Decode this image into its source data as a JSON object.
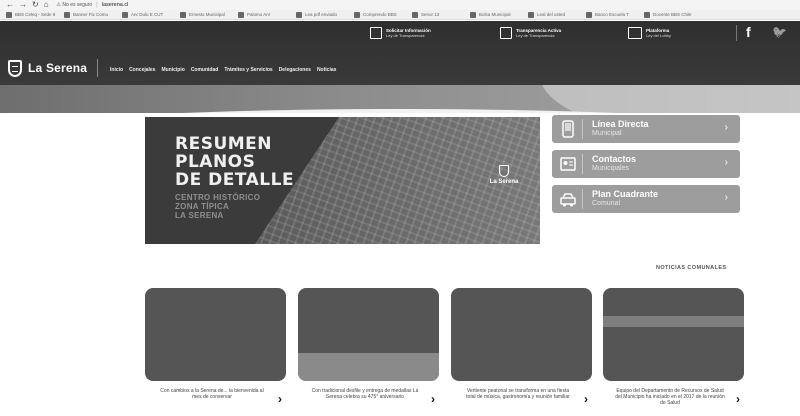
{
  "browser": {
    "secure_label": "No es seguro",
    "url": "laserena.cl",
    "bookmarks": [
      "BBS Celeq - Sede 8",
      "Banner Fix Comu",
      "Anr Dulu E CUT",
      "Ernesto Munisipal",
      "Palomo Anr",
      "Lea pdf enviado",
      "Comprendo BBS",
      "Senor 13",
      "Bolsa Municipal",
      "Leal del usted",
      "Banco Escuela T",
      "Docente BBS Chile"
    ]
  },
  "topbar": {
    "items": [
      {
        "line1": "Solicitar Información",
        "line2": "Ley de Transparencia"
      },
      {
        "line1": "Transparencia Activa",
        "line2": "Ley de Transparencia"
      },
      {
        "line1": "Plataforma",
        "line2": "Ley del Lobby"
      }
    ],
    "social": [
      "f",
      "🐦"
    ]
  },
  "logo": {
    "text": "La Serena"
  },
  "nav": [
    "Inicio",
    "Concejales",
    "Municipio",
    "Comunidad",
    "Trámites y Servicios",
    "Delegaciones",
    "Noticias"
  ],
  "hero": {
    "title": "RESUMEN\nPLANOS\nDE DETALLE",
    "subtitle": "CENTRO HISTÓRICO\nZONA TÍPICA\nLA SERENA",
    "badge": "La Serena"
  },
  "quick_links": [
    {
      "title": "Línea Directa",
      "subtitle": "Municipal",
      "icon": "phone-icon"
    },
    {
      "title": "Contactos",
      "subtitle": "Municipales",
      "icon": "contact-card-icon"
    },
    {
      "title": "Plan Cuadrante",
      "subtitle": "Comunal",
      "icon": "police-car-icon"
    }
  ],
  "news": {
    "heading": "NOTICIAS COMUNALES",
    "items": [
      {
        "caption": "Con cambios a la Serena de... la bienvenida al mes de conservar"
      },
      {
        "caption": "Con tradicional desfile y entrega de medallas La Serena celebra su 475° aniversario"
      },
      {
        "caption": "Vertiente peatonal se transforma en una fiesta total de música, gastronomía y reunión familiar"
      },
      {
        "caption": "Equipo del Departamento de Recursos de Salud del Municipio ha iniciado en el 2017 de la reunión de Salud"
      }
    ]
  }
}
